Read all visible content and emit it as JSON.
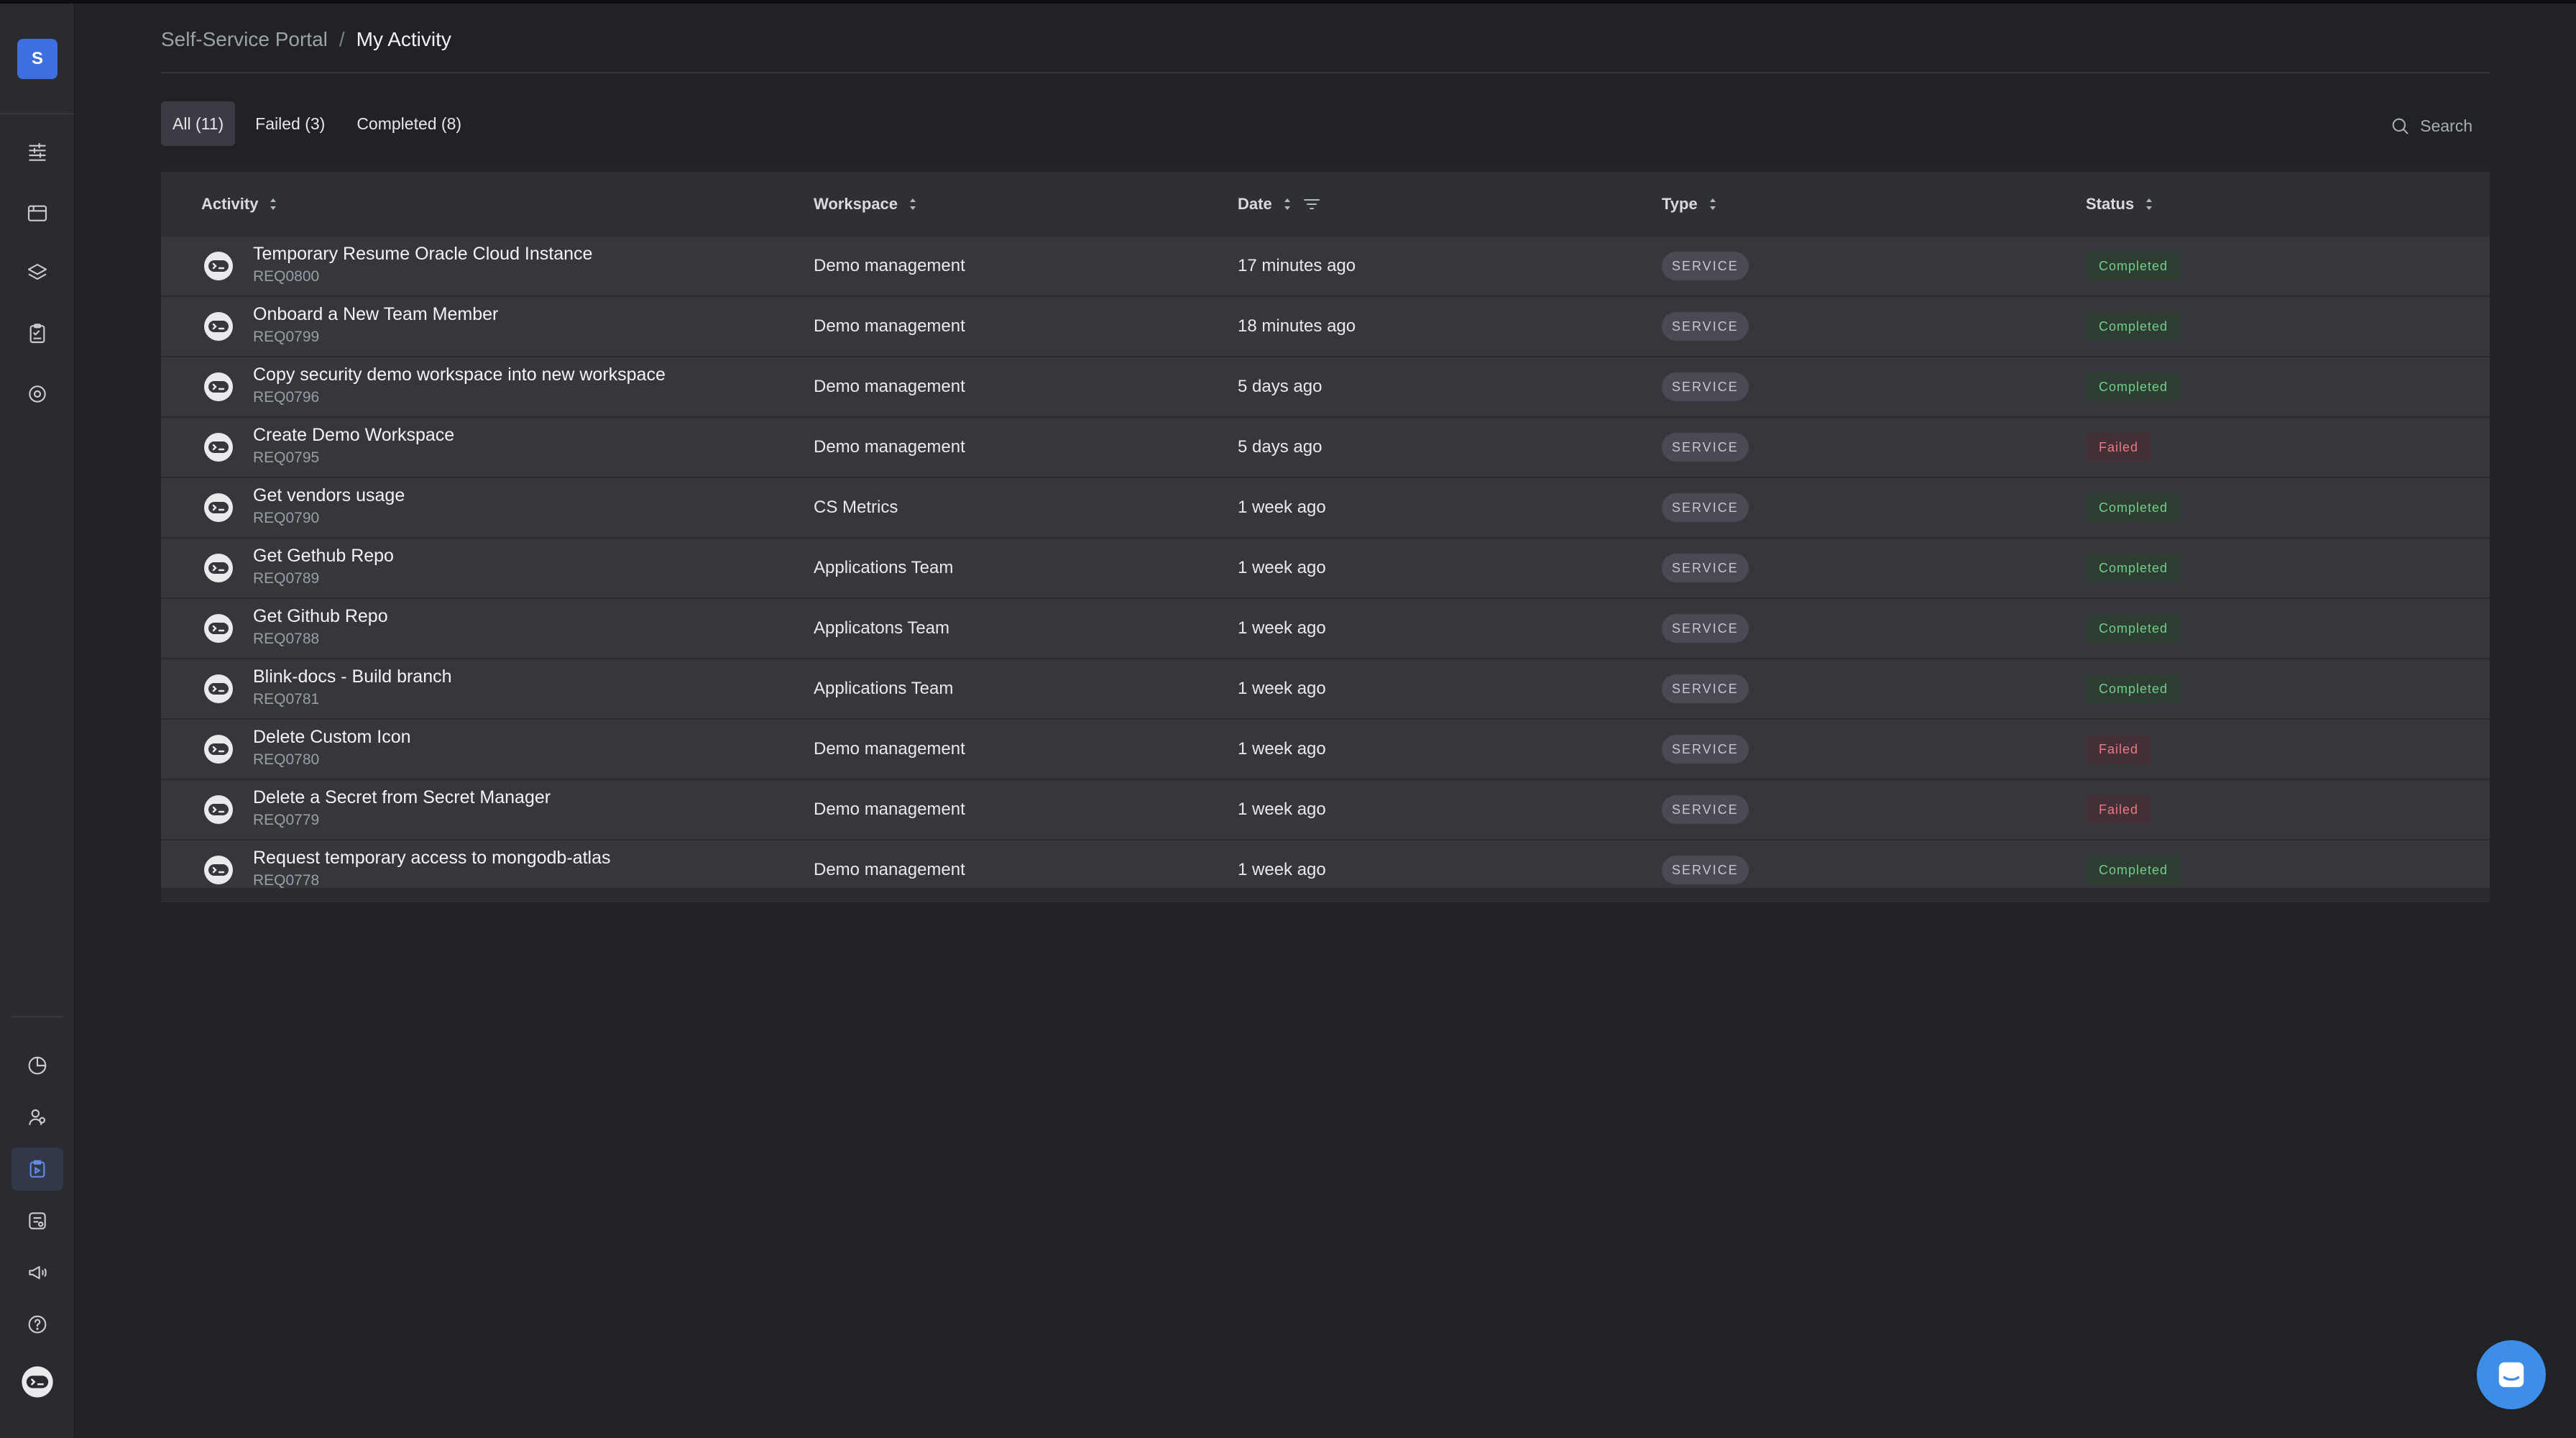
{
  "sidebar": {
    "avatar_letter": "S",
    "top_icons": [
      "catalog-icon",
      "calendar-board-icon",
      "layers-icon",
      "clipboard-icon",
      "settings-gear-icon"
    ],
    "bottom_icons": [
      "analytics-pie-icon",
      "users-icon",
      "my-activity-icon",
      "cases-icon",
      "announcements-icon",
      "help-icon",
      "blink-logo-icon"
    ],
    "active_item": "my-activity-icon"
  },
  "breadcrumb": {
    "root": "Self-Service Portal",
    "separator": "/",
    "current": "My Activity"
  },
  "tabs": [
    {
      "label": "All (11)",
      "active": true
    },
    {
      "label": "Failed (3)",
      "active": false
    },
    {
      "label": "Completed (8)",
      "active": false
    }
  ],
  "search": {
    "label": "Search"
  },
  "table": {
    "columns": [
      {
        "label": "Activity",
        "sortable": true
      },
      {
        "label": "Workspace",
        "sortable": true
      },
      {
        "label": "Date",
        "sortable": true,
        "filter": true
      },
      {
        "label": "Type",
        "sortable": true
      },
      {
        "label": "Status",
        "sortable": true
      }
    ],
    "rows": [
      {
        "title": "Temporary Resume Oracle Cloud Instance",
        "id": "REQ0800",
        "workspace": "Demo management",
        "date": "17 minutes ago",
        "type": "SERVICE",
        "status": "Completed"
      },
      {
        "title": "Onboard a New Team Member",
        "id": "REQ0799",
        "workspace": "Demo management",
        "date": "18 minutes ago",
        "type": "SERVICE",
        "status": "Completed"
      },
      {
        "title": "Copy security demo workspace into new workspace",
        "id": "REQ0796",
        "workspace": "Demo management",
        "date": "5 days ago",
        "type": "SERVICE",
        "status": "Completed"
      },
      {
        "title": "Create Demo Workspace",
        "id": "REQ0795",
        "workspace": "Demo management",
        "date": "5 days ago",
        "type": "SERVICE",
        "status": "Failed"
      },
      {
        "title": "Get vendors usage",
        "id": "REQ0790",
        "workspace": "CS Metrics",
        "date": "1 week ago",
        "type": "SERVICE",
        "status": "Completed"
      },
      {
        "title": "Get Gethub Repo",
        "id": "REQ0789",
        "workspace": "Applications Team",
        "date": "1 week ago",
        "type": "SERVICE",
        "status": "Completed"
      },
      {
        "title": "Get Github Repo",
        "id": "REQ0788",
        "workspace": "Applicatons Team",
        "date": "1 week ago",
        "type": "SERVICE",
        "status": "Completed"
      },
      {
        "title": "Blink-docs - Build branch",
        "id": "REQ0781",
        "workspace": "Applications Team",
        "date": "1 week ago",
        "type": "SERVICE",
        "status": "Completed"
      },
      {
        "title": "Delete Custom Icon",
        "id": "REQ0780",
        "workspace": "Demo management",
        "date": "1 week ago",
        "type": "SERVICE",
        "status": "Failed"
      },
      {
        "title": "Delete a Secret from Secret Manager",
        "id": "REQ0779",
        "workspace": "Demo management",
        "date": "1 week ago",
        "type": "SERVICE",
        "status": "Failed"
      },
      {
        "title": "Request temporary access to mongodb-atlas",
        "id": "REQ0778",
        "workspace": "Demo management",
        "date": "1 week ago",
        "type": "SERVICE",
        "status": "Completed"
      }
    ]
  },
  "colors": {
    "accent": "#3d6fe0",
    "completed": "#6fd08a",
    "failed": "#e77a86",
    "chat_button": "#3e8ee8"
  }
}
